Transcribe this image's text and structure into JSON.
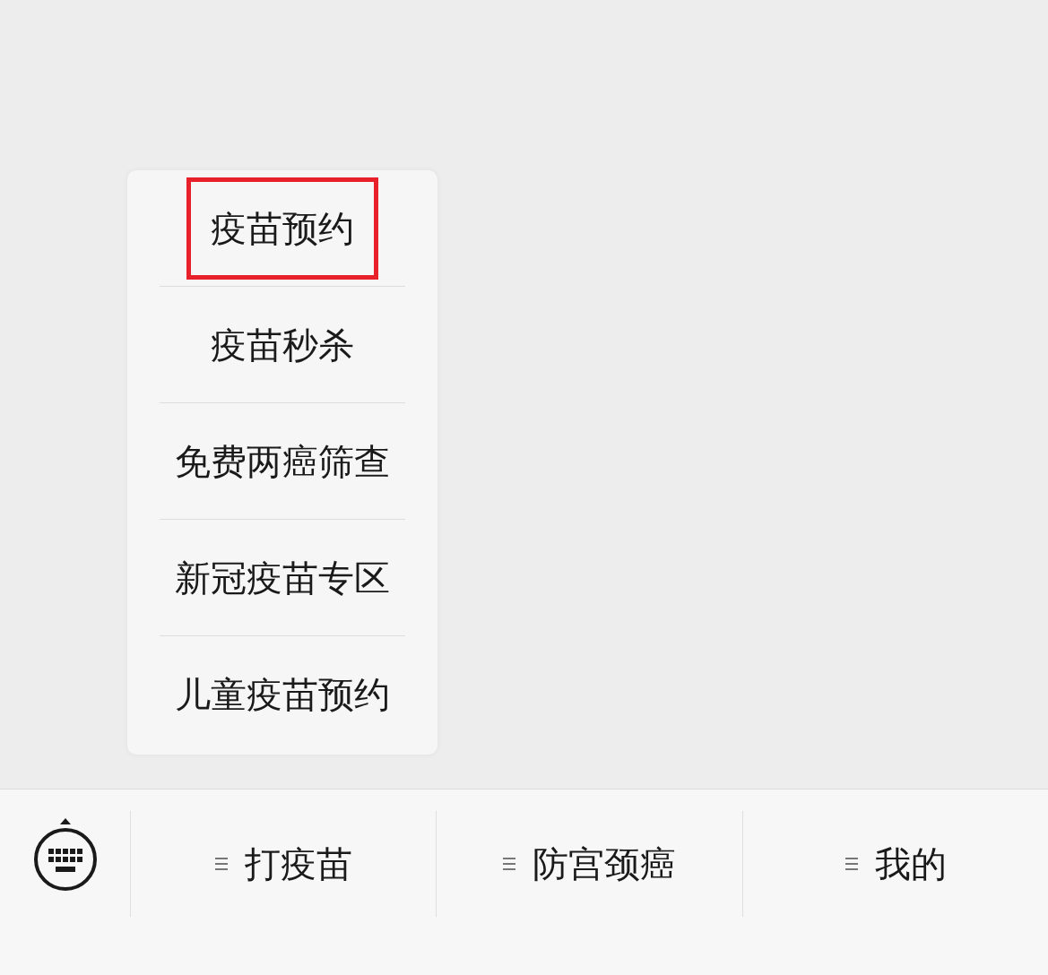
{
  "menu_bar": {
    "items": [
      {
        "label": "打疫苗",
        "submenu": [
          {
            "label": "疫苗预约",
            "highlighted": true
          },
          {
            "label": "疫苗秒杀",
            "highlighted": false
          },
          {
            "label": "免费两癌筛查",
            "highlighted": false
          },
          {
            "label": "新冠疫苗专区",
            "highlighted": false
          },
          {
            "label": "儿童疫苗预约",
            "highlighted": false
          }
        ]
      },
      {
        "label": "防宫颈癌"
      },
      {
        "label": "我的"
      }
    ]
  }
}
